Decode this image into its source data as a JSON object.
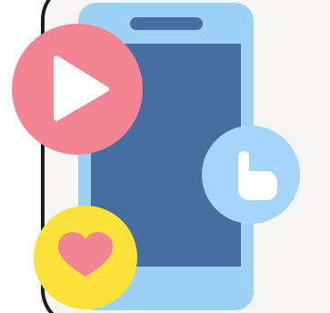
{
  "illustration": {
    "colors": {
      "panel_bg": "#f8f6f5",
      "panel_border": "#1d1d1d",
      "phone_frame": "#9dd2f6",
      "phone_screen": "#466e9f",
      "speaker_slot": "#466e9f",
      "play_badge": "#f38493",
      "play_triangle": "#ffffff",
      "heart_badge": "#fde23b",
      "heart": "#f38493",
      "letter_badge": "#a5d5fa",
      "letter": "#ffffff"
    },
    "icons": [
      "smartphone-icon",
      "play-icon",
      "heart-icon",
      "blogger-icon"
    ]
  }
}
